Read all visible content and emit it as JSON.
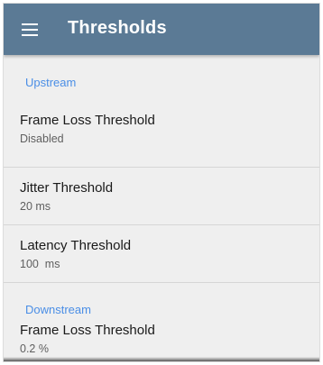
{
  "appbar": {
    "title": "Thresholds",
    "menu_icon": "hamburger-menu-icon",
    "color": "#5b7a95"
  },
  "sections": {
    "upstream": {
      "label": "Upstream",
      "items": [
        {
          "title": "Frame Loss Threshold",
          "value": "Disabled"
        },
        {
          "title": "Jitter Threshold",
          "value": "20 ms"
        },
        {
          "title": "Latency Threshold",
          "value": "100  ms"
        }
      ]
    },
    "downstream": {
      "label": "Downstream",
      "items": [
        {
          "title": "Frame Loss Threshold",
          "value": "0.2 %"
        }
      ]
    }
  },
  "colors": {
    "section_label": "#4a8ee6",
    "background": "#efefef"
  }
}
